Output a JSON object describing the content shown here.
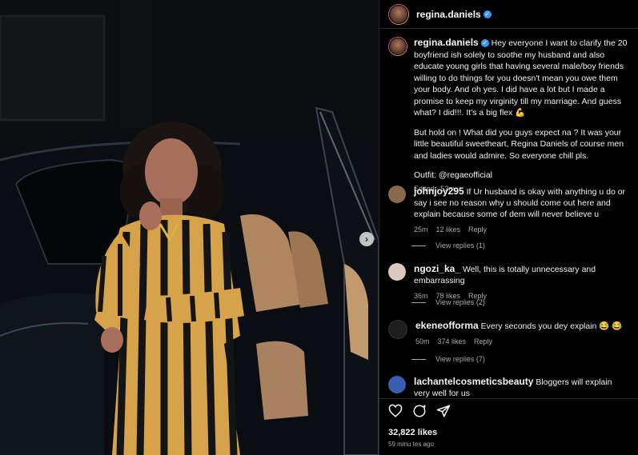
{
  "header": {
    "username": "regina.daniels"
  },
  "caption": {
    "username": "regina.daniels",
    "paragraph_1": "Hey everyone I want to clarify the 20 boyfriend ish solely to soothe my husband and also educate young girls that having several male/boy friends willing to do things for you doesn't mean you owe them your body. And oh yes. I did have a lot but I made a promise to keep my virginity till my marriage. And guess what? I did!!!. It's a big flex 💪",
    "paragraph_2": "But hold on ! What did you guys expect na ? It was your little beautiful sweetheart, Regina Daniels of course men and ladies would admire. So everyone chill pls.",
    "paragraph_3": "Outfit: @regaeofficial",
    "edited": "Edited",
    "time": "53m"
  },
  "comments": [
    {
      "username": "johnjoy295",
      "text": "If Ur husband is okay with anything u do or say i see no reason why u should come out here and explain because some of dem will never believe u",
      "time": "25m",
      "likes": "12 likes",
      "reply": "Reply",
      "view_replies": "View replies (1)",
      "avatar_color": "#8a6a4e"
    },
    {
      "username": "ngozi_ka_",
      "text": "Well, this is totally unnecessary and embarrassing",
      "time": "36m",
      "likes": "78 likes",
      "reply": "Reply",
      "view_replies": "View replies (2)",
      "avatar_color": "#d9c9bf"
    },
    {
      "username": "ekeneofforma",
      "text": "Every seconds you dey explain 😂 😂",
      "time": "50m",
      "likes": "374 likes",
      "reply": "Reply",
      "view_replies": "View replies (7)",
      "avatar_color": "#1e1e1e"
    },
    {
      "username": "lachantelcosmeticsbeauty",
      "text": "Bloggers will explain very well for us",
      "avatar_color": "#3a5fb0"
    }
  ],
  "actions": {
    "like_icon": "heart-icon",
    "comment_icon": "comment-icon",
    "share_icon": "share-icon",
    "likes": "32,822 likes",
    "time_ago": "59 minu tes ago"
  },
  "colors": {
    "verified": "#3897f0",
    "background": "#000000",
    "muted": "#a8a8a8"
  }
}
